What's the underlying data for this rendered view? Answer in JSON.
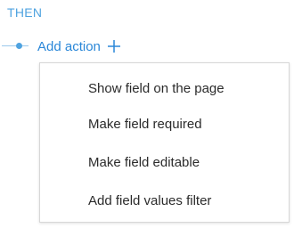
{
  "section": {
    "label": "THEN"
  },
  "add_action": {
    "label": "Add action",
    "icon": "plus-icon"
  },
  "menu": {
    "items": [
      {
        "label": "Show field on the page"
      },
      {
        "label": "Make field required"
      },
      {
        "label": "Make field editable"
      },
      {
        "label": "Add field values filter"
      }
    ]
  },
  "colors": {
    "accent": "#4fa3e0",
    "link": "#2a87d8",
    "text": "#2b2b2b",
    "border": "#d7d7d7"
  }
}
